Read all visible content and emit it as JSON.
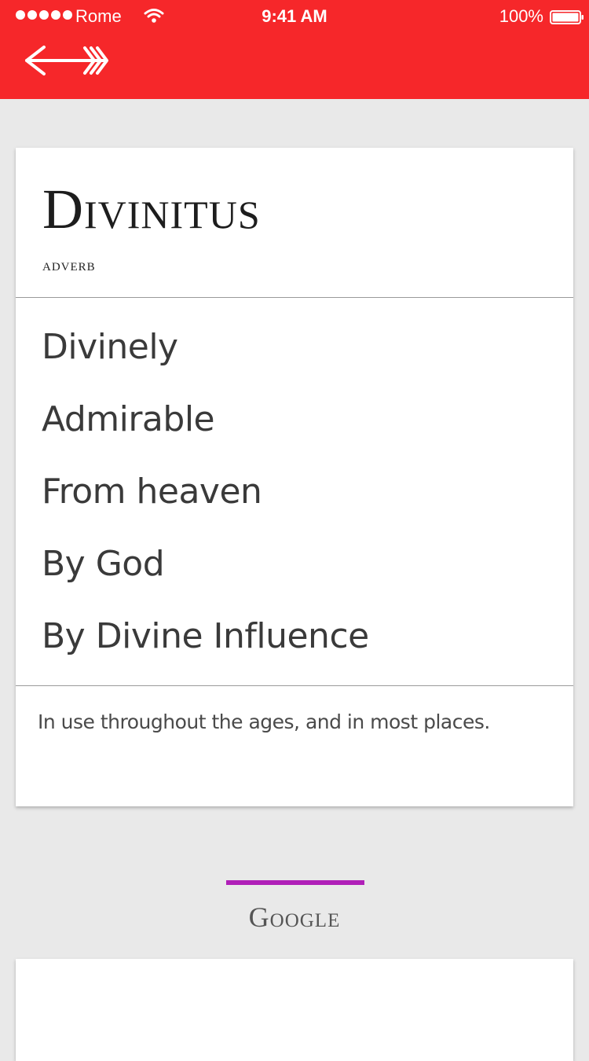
{
  "status_bar": {
    "carrier": "Rome",
    "time": "9:41 AM",
    "battery": "100%",
    "signal_icon": "signal-dots-icon",
    "wifi_icon": "wifi-icon",
    "battery_icon": "battery-icon"
  },
  "header": {
    "back_icon": "arrow-left-icon",
    "color": "#f6272a"
  },
  "entry": {
    "word": "Divinitus",
    "part_of_speech": "adverb",
    "meanings": [
      "Divinely",
      "Admirable",
      "From heaven",
      "By God",
      "By Divine Influence"
    ],
    "usage_note": "In use throughout the ages, and in most places."
  },
  "google_section": {
    "title": "Google",
    "accent_color": "#b020b8"
  }
}
